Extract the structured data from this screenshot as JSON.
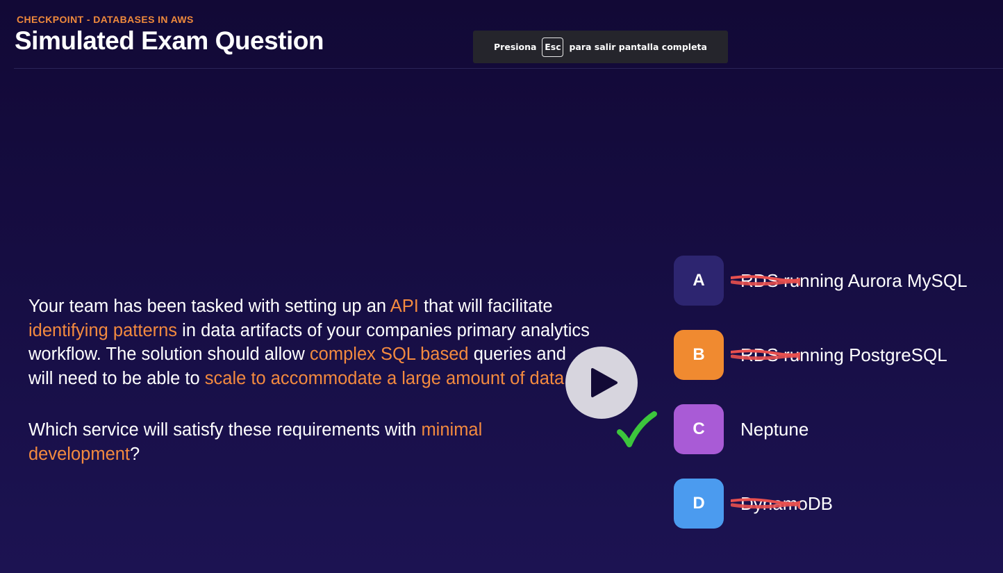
{
  "header": {
    "eyebrow": "CHECKPOINT - DATABASES IN AWS",
    "title": "Simulated Exam Question"
  },
  "fullscreen_notice": {
    "before": "Presiona",
    "key": "Esc",
    "after": "para salir pantalla completa",
    "background": "#25252c"
  },
  "question": {
    "p1": [
      {
        "t": "Your team has been tasked with setting up an ",
        "hl": false
      },
      {
        "t": "API",
        "hl": true
      },
      {
        "t": " that will facilitate ",
        "hl": false
      },
      {
        "t": "identifying patterns",
        "hl": true
      },
      {
        "t": " in data artifacts of your companies primary analytics workflow. The solution should allow ",
        "hl": false
      },
      {
        "t": "complex SQL based",
        "hl": true
      },
      {
        "t": " queries and will need to be able to ",
        "hl": false
      },
      {
        "t": "scale to accommodate a large amount of data",
        "hl": true
      },
      {
        "t": ".",
        "hl": false
      }
    ],
    "p2": [
      {
        "t": "Which service will satisfy these requirements with ",
        "hl": false
      },
      {
        "t": "minimal development",
        "hl": true
      },
      {
        "t": "?",
        "hl": false
      }
    ],
    "highlight_color": "#f38a3f"
  },
  "options": [
    {
      "letter": "A",
      "text": "RDS running Aurora MySQL",
      "color": "#2d2570",
      "struck": true
    },
    {
      "letter": "B",
      "text": "RDS running PostgreSQL",
      "color": "#f08a30",
      "struck": true
    },
    {
      "letter": "C",
      "text": "Neptune",
      "color": "#a95bd6",
      "struck": false
    },
    {
      "letter": "D",
      "text": "DynamoDB",
      "color": "#4b9bef",
      "struck": true
    }
  ],
  "correct_option": "C",
  "icons": {
    "play": "play-icon",
    "check": "checkmark-icon",
    "strike": "strikethrough-mark"
  },
  "colors": {
    "background": "#160d42",
    "accent": "#f38a3f",
    "check": "#3cc63c",
    "strike": "#e8504f"
  }
}
